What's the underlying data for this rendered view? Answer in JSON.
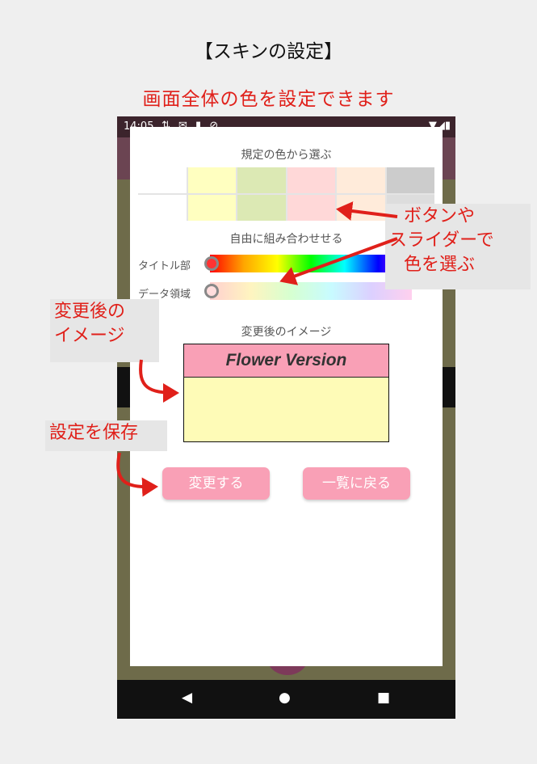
{
  "heading": "【スキンの設定】",
  "subheading": "画面全体の色を設定できます",
  "status_bar": {
    "time": "14:05",
    "left_icons": "⇅ ✉ ▮ ⊘",
    "right_icons": "▼◢▮"
  },
  "dialog": {
    "preset_title": "規定の色から選ぶ",
    "preset_colors": [
      "#ffffff",
      "#ffffc0",
      "#dce9b4",
      "#ffd8d8",
      "#ffebda",
      "#cccccc",
      "#ffffff",
      "#ffffc0",
      "#dce9b4",
      "#ffd8d8",
      "#ffebda",
      "#dddddd"
    ],
    "free_title": "自由に組み合わせせる",
    "title_part_label": "タイトル部",
    "data_area_label": "データ領域",
    "preview_title": "変更後のイメージ",
    "preview_header_text": "Flower Version",
    "change_button": "変更する",
    "back_button": "一覧に戻る"
  },
  "nav": {
    "back": "◀",
    "home": "●",
    "recents": "■"
  },
  "annotations": {
    "buttons_sliders_line1": "ボタンや",
    "buttons_sliders_line2": "スライダーで",
    "buttons_sliders_line3": "色を選ぶ",
    "preview_line1": "変更後の",
    "preview_line2": "イメージ",
    "save": "設定を保存"
  },
  "colors": {
    "accent_pink": "#f9a0b6",
    "annotation_red": "#e0201a",
    "preview_body": "#fefbb7"
  }
}
